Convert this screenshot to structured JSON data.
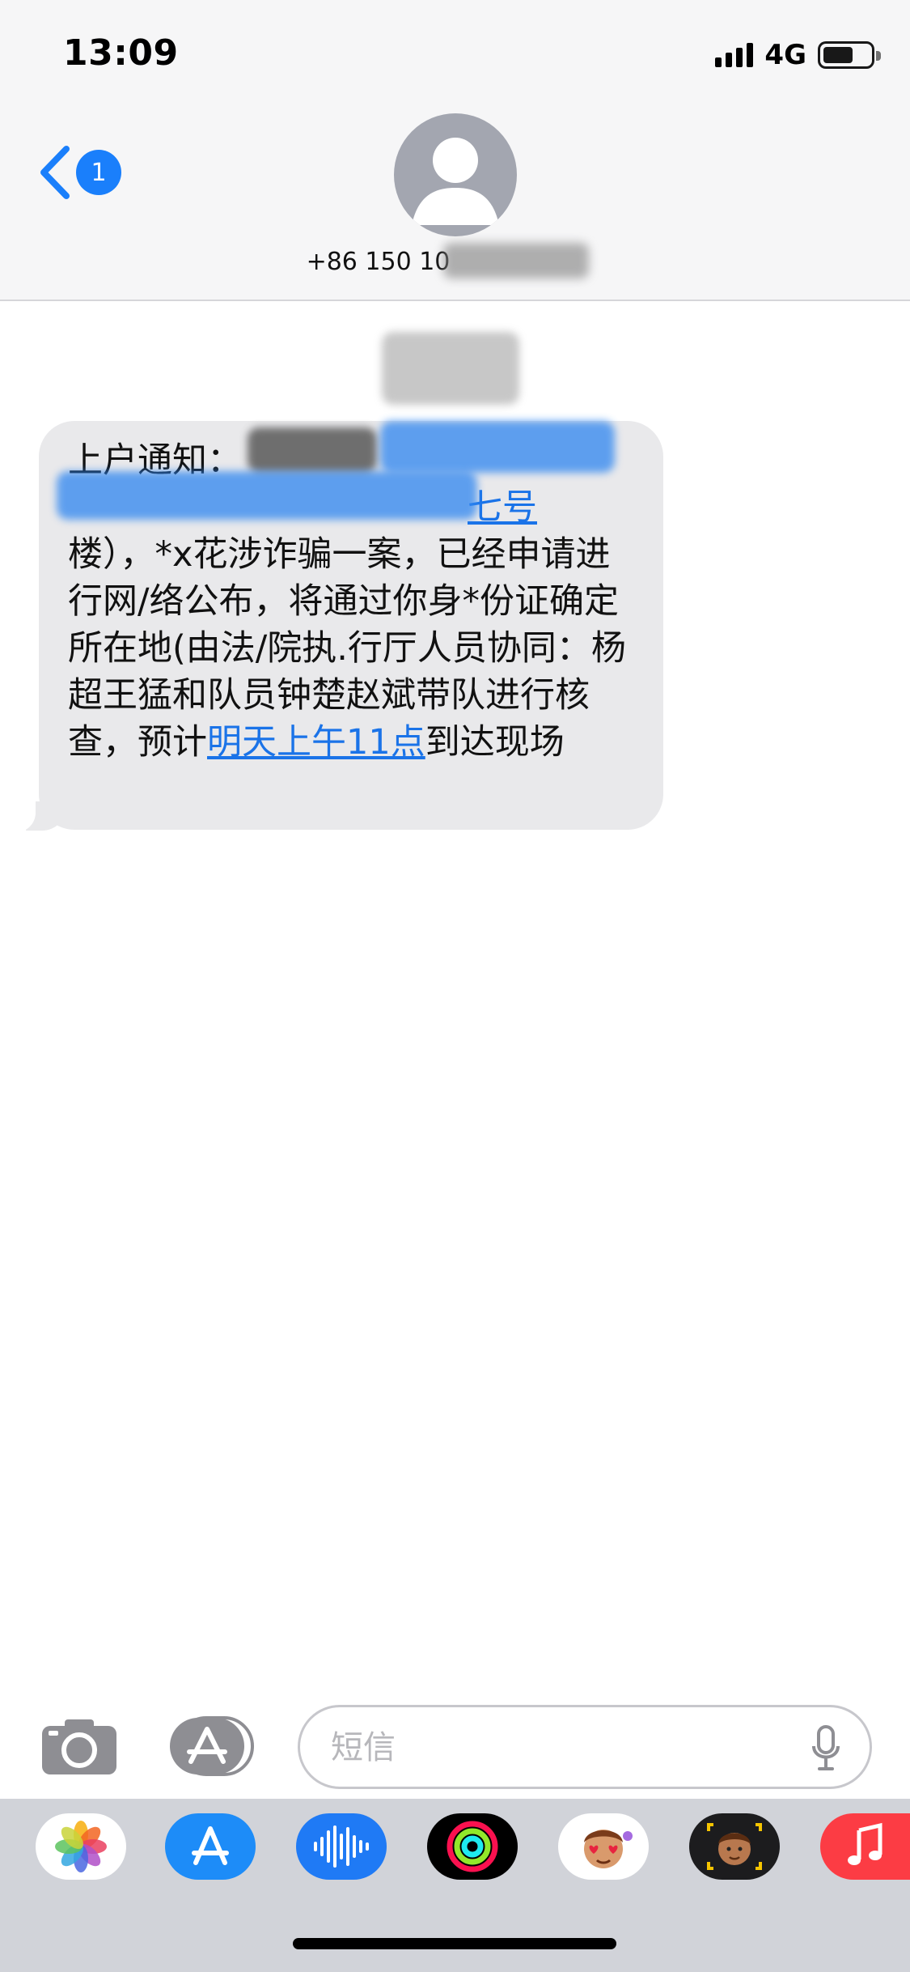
{
  "status_bar": {
    "time": "13:09",
    "network": "4G"
  },
  "header": {
    "back_badge_count": "1",
    "contact_number": "+86 150 10"
  },
  "message": {
    "line1_prefix": "上户通知：",
    "line2_link_end": "七号",
    "body_part1": "楼），*x花涉诈骗一案，已经申请进行网/络公布，将通过你身*份证确定所在地(由法/院执.行厅人员协同：杨超王猛和队员钟楚赵斌带队进行核查，预计",
    "body_link": "明天上午11点",
    "body_part2": "到达现场"
  },
  "composer": {
    "placeholder": "短信"
  },
  "app_drawer": {
    "apps": [
      "photos-app",
      "app-store-app",
      "audio-messages-app",
      "fitness-app",
      "animoji-stickers-app",
      "memoji-app",
      "music-app"
    ]
  },
  "colors": {
    "link_blue": "#1a73e8",
    "badge_blue": "#1a7ffb",
    "bubble_gray": "#e9e9eb",
    "drawer_gray": "#d1d3d9"
  }
}
